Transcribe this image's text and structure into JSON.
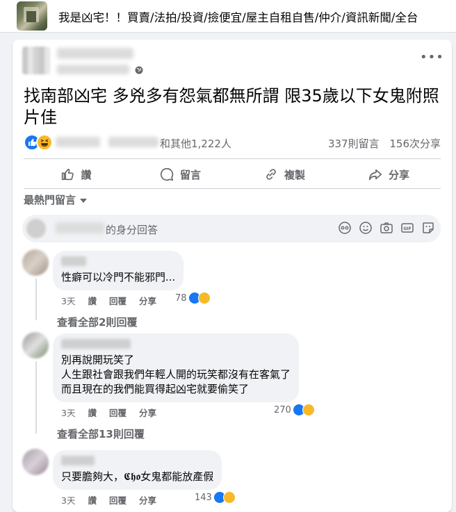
{
  "group": {
    "name": "我是凶宅！！買賣/法拍/投資/撿便宜/屋主自租自售/仲介/資訊新聞/全台"
  },
  "post": {
    "title": "找南部凶宅 多兇多有怨氣都無所謂 限35歲以下女鬼附照片佳",
    "reactions_others": "和其他1,222人",
    "comments_count": "337則留言",
    "shares_count": "156次分享",
    "actions": {
      "like": "讚",
      "comment": "留言",
      "copy": "複製",
      "share": "分享"
    },
    "sort_label": "最熱門留言",
    "compose_placeholder": "的身分回答"
  },
  "comments": [
    {
      "lines": [
        "性癖可以冷門不能邪門..."
      ],
      "time": "3天",
      "like": "讚",
      "reply": "回覆",
      "share": "分享",
      "reactions": "78",
      "view_replies": "查看全部2則回覆"
    },
    {
      "lines": [
        "別再說開玩笑了",
        "人生跟社會跟我們年輕人開的玩笑都沒有在客氣了",
        "而且現在的我們能買得起凶宅就要偷笑了"
      ],
      "time": "3天",
      "like": "讚",
      "reply": "回覆",
      "share": "分享",
      "reactions": "270",
      "view_replies": "查看全部13則回覆"
    },
    {
      "lines": [
        "只要膽夠大，𝕮𝖍𝖔女鬼都能放產假"
      ],
      "time": "3天",
      "like": "讚",
      "reply": "回覆",
      "share": "分享",
      "reactions": "143"
    }
  ],
  "colors": {
    "like_blue": "#1877f2",
    "haha_yellow": "#f7b928",
    "secondary_text": "#65676b"
  }
}
